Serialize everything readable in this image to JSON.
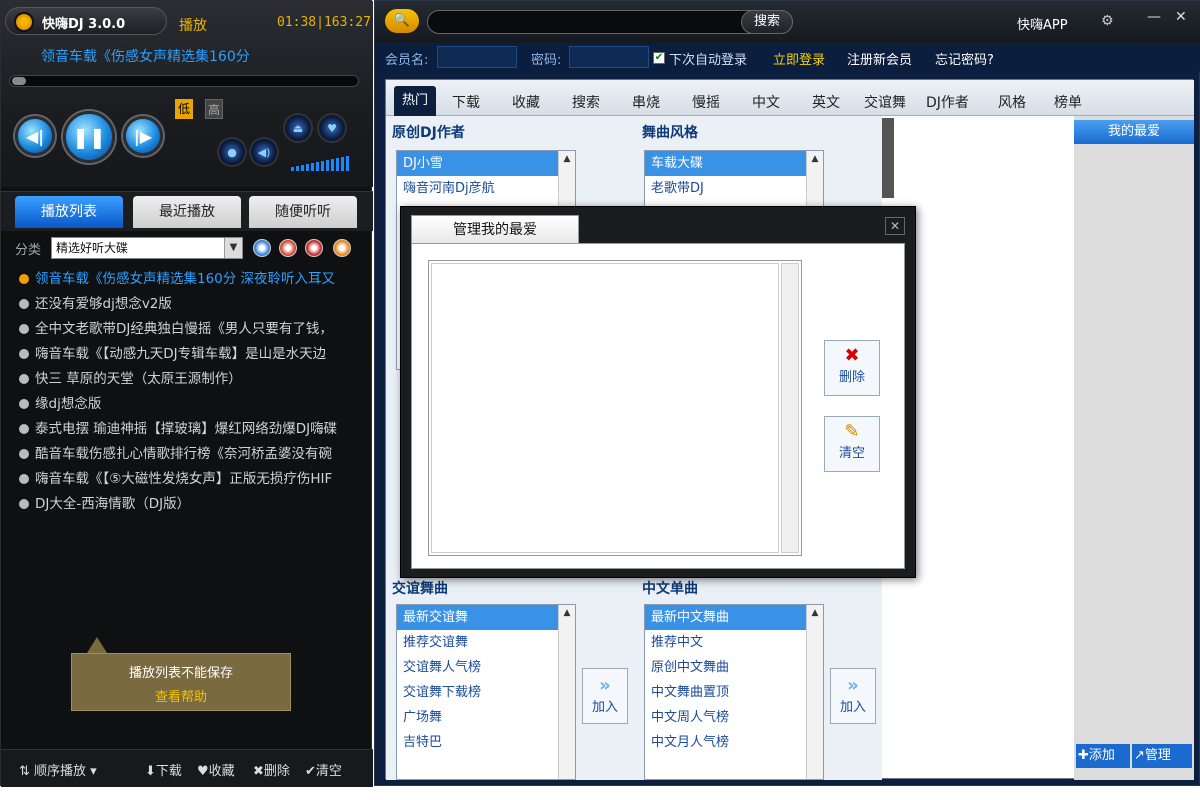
{
  "app": {
    "name": "快嗨DJ 3.0.0",
    "status": "播放",
    "time": "01:38|163:27"
  },
  "now_playing": "领音车载《伤感女声精选集160分",
  "quality": {
    "low": "低",
    "high": "高"
  },
  "left_tabs": [
    "播放列表",
    "最近播放",
    "随便听听"
  ],
  "category": {
    "label": "分类",
    "value": "精选好听大碟"
  },
  "playlist": [
    "领音车载《伤感女声精选集160分 深夜聆听入耳又",
    "还没有爱够dj想念v2版",
    "全中文老歌带DJ经典独白慢摇《男人只要有了钱，",
    "嗨音车载《【动感九天DJ专辑车载】是山是水天边",
    "快三 草原的天堂（太原王源制作）",
    "缘dj想念版",
    "泰式电摆 瑜迪神摇【撑玻璃】爆红网络劲爆DJ嗨碟",
    "酷音车载伤感扎心情歌排行榜《奈河桥孟婆没有碗",
    "嗨音车载《【⑤大磁性发烧女声】正版无损疗伤HIF",
    "DJ大全-西海情歌（DJ版）"
  ],
  "tip": {
    "text": "播放列表不能保存",
    "link": "查看帮助"
  },
  "left_bottom": [
    "顺序播放",
    "下载",
    "收藏",
    "删除",
    "清空"
  ],
  "search": {
    "button": "搜索",
    "value": ""
  },
  "app_label": "快嗨APP",
  "login": {
    "member_label": "会员名:",
    "password_label": "密码:",
    "auto_login": "下次自动登录",
    "login_now": "立即登录",
    "register": "注册新会员",
    "forgot": "忘记密码?"
  },
  "main_tabs": [
    "热门",
    "下载",
    "收藏",
    "搜索",
    "串烧",
    "慢摇",
    "中文",
    "英文",
    "交谊舞",
    "DJ作者",
    "风格",
    "榜单"
  ],
  "sections": {
    "dj_authors": {
      "title": "原创DJ作者",
      "items": [
        "DJ小雪",
        "嗨音河南Dj彦航"
      ]
    },
    "dance_styles": {
      "title": "舞曲风格",
      "items": [
        "车载大碟",
        "老歌带DJ"
      ]
    },
    "ballroom": {
      "title": "交谊舞曲",
      "items": [
        "最新交谊舞",
        "推荐交谊舞",
        "交谊舞人气榜",
        "交谊舞下载榜",
        "广场舞",
        "吉特巴"
      ],
      "add": "加入"
    },
    "chinese_singles": {
      "title": "中文单曲",
      "items": [
        "最新中文舞曲",
        "推荐中文",
        "原创中文舞曲",
        "中文舞曲置顶",
        "中文周人气榜",
        "中文月人气榜"
      ],
      "add": "加入"
    }
  },
  "favorites": {
    "header": "我的最爱",
    "add": "添加",
    "manage": "管理"
  },
  "modal": {
    "title": "管理我的最爱",
    "delete": "删除",
    "clear": "清空"
  },
  "colors": {
    "accent_blue": "#2aa0ff",
    "gold": "#e8b400",
    "dark_bg": "#0f1012",
    "navy": "#0c1f3e"
  }
}
